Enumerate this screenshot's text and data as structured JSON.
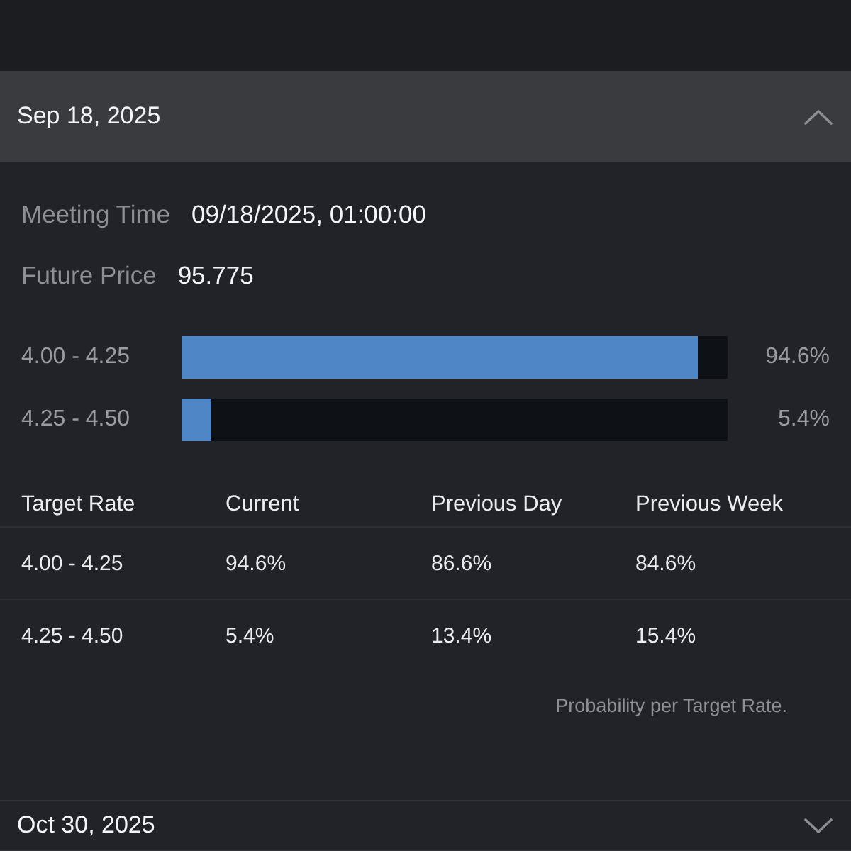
{
  "sections": [
    {
      "date": "Sep 18, 2025",
      "expanded": true,
      "details": [
        {
          "label": "Meeting Time",
          "value": "09/18/2025, 01:00:00"
        },
        {
          "label": "Future Price",
          "value": "95.775"
        }
      ],
      "bars": [
        {
          "label": "4.00 - 4.25",
          "level": 0.946,
          "reading": "94.6%"
        },
        {
          "label": "4.25 - 4.50",
          "level": 0.054,
          "reading": "5.4%"
        }
      ],
      "table": {
        "columns": [
          "Target Rate",
          "Current",
          "Previous Day",
          "Previous Week"
        ],
        "rows": [
          [
            "4.00 - 4.25",
            "94.6%",
            "86.6%",
            "84.6%"
          ],
          [
            "4.25 - 4.50",
            "5.4%",
            "13.4%",
            "15.4%"
          ]
        ]
      },
      "note": "Probability per Target Rate."
    },
    {
      "date": "Oct 30, 2025",
      "expanded": false
    }
  ]
}
